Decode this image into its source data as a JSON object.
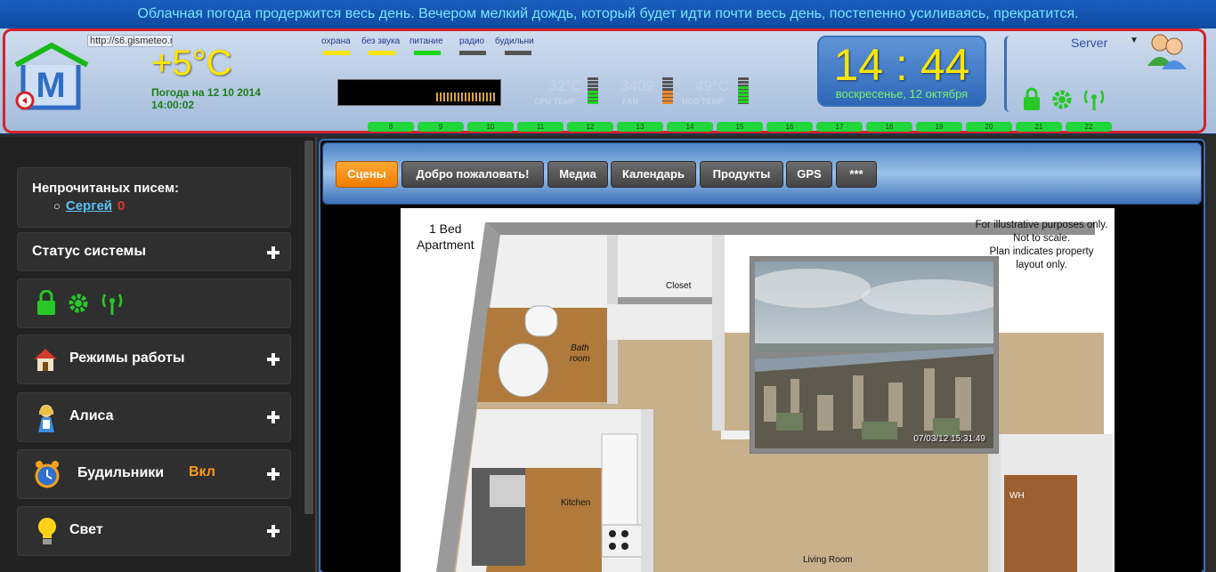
{
  "ticker": "Облачная погода продержится весь день. Вечером мелкий дождь, который будет идти почти весь день, постепенно усиливаясь, прекратится.",
  "weather": {
    "url": "http://s6.gismeteo.r",
    "temperature": "+5°C",
    "date_line": "Погода на 12 10 2014",
    "time_line": "14:00:02"
  },
  "indicators": [
    {
      "label": "охрана",
      "color": "#f5e60a"
    },
    {
      "label": "без звука",
      "color": "#f5e60a"
    },
    {
      "label": "питание",
      "color": "#18d818"
    },
    {
      "label": "радио",
      "color": "#555555"
    },
    {
      "label": "будильни",
      "color": "#555555"
    }
  ],
  "metrics": [
    {
      "value": "32°C",
      "label": "CPU TEMP",
      "level": 0.5,
      "gauge_color": "#22d422"
    },
    {
      "value": "3409",
      "label": "FAN",
      "level": 0.5,
      "gauge_color": "#f08a2a"
    },
    {
      "value": "49°C",
      "label": "HDD TEMP",
      "level": 0.65,
      "gauge_color": "#22d422"
    }
  ],
  "hours": [
    "8",
    "9",
    "10",
    "11",
    "12",
    "13",
    "14",
    "15",
    "16",
    "17",
    "18",
    "19",
    "20",
    "21",
    "22"
  ],
  "clock": {
    "time": "14 : 44",
    "date": "воскресенье,  12 октября"
  },
  "user": {
    "server": "Server",
    "caret": "▼"
  },
  "sidebar": {
    "mail_title": "Непрочитаных писем:",
    "mail_user": "Сергей",
    "mail_count": "0",
    "status_title": "Статус системы",
    "modes_title": "Режимы работы",
    "alice_title": "Алиса",
    "alarm_title": "Будильники",
    "alarm_state": "Вкл",
    "light_title": "Свет"
  },
  "tabs": [
    {
      "label": "Сцены",
      "active": true
    },
    {
      "label": "Добро пожаловать!",
      "active": false
    },
    {
      "label": "Медиа",
      "active": false
    },
    {
      "label": "Календарь",
      "active": false
    },
    {
      "label": "Продукты",
      "active": false
    },
    {
      "label": "GPS",
      "active": false
    },
    {
      "label": "***",
      "active": false
    }
  ],
  "floorplan": {
    "title_line1": "1 Bed",
    "title_line2": "Apartment",
    "note1": "For illustrative purposes only.",
    "note2": "Not to scale.",
    "note3": "Plan indicates property",
    "note4": "layout only.",
    "closet": "Closet",
    "bath1": "Bath",
    "bath2": "room",
    "kitchen": "Kitchen",
    "living": "Living Room",
    "wh": "WH",
    "camera_timestamp": "07/03/12 15:31:49"
  },
  "colors": {
    "accent_orange": "#f17c00",
    "led_green": "#20d63a",
    "clock_yellow": "#ffe600",
    "alert_red": "#d2232a"
  }
}
